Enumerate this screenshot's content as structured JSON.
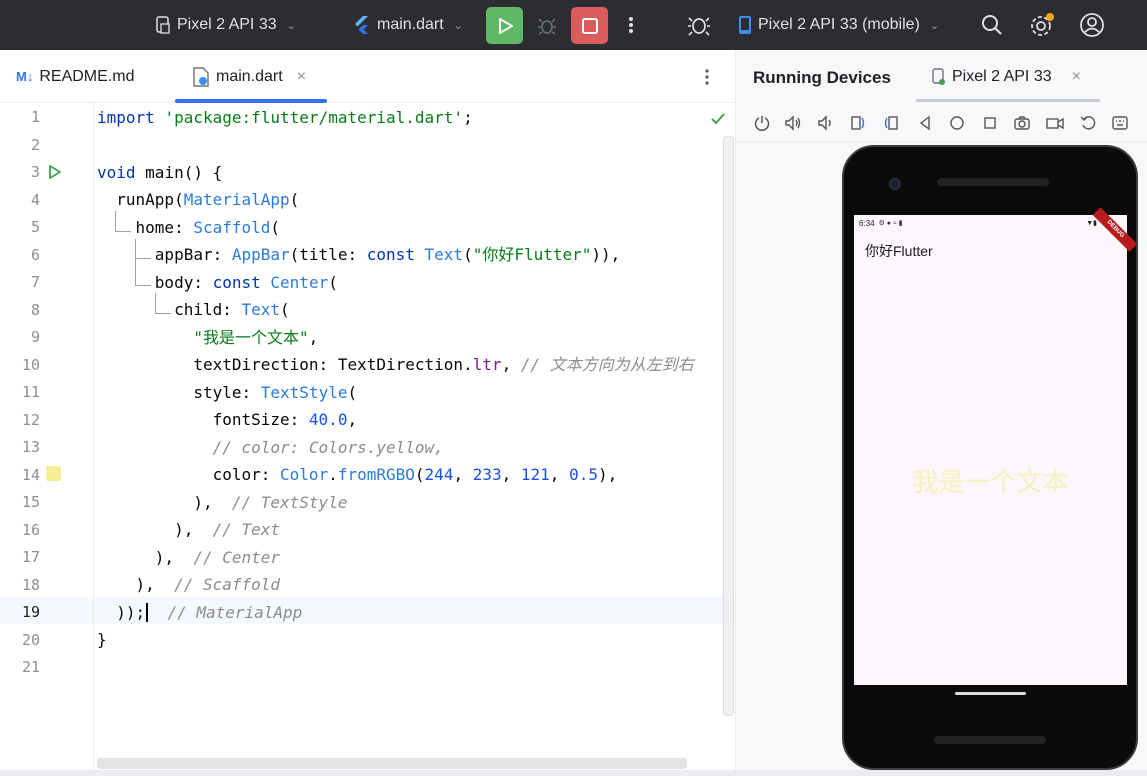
{
  "toolbar": {
    "device_selector": "Pixel 2 API 33",
    "file_selector": "main.dart",
    "running_device": "Pixel 2 API 33 (mobile)"
  },
  "tabs": [
    {
      "label": "README.md"
    },
    {
      "label": "main.dart"
    }
  ],
  "editor": {
    "line_numbers": [
      "1",
      "2",
      "3",
      "4",
      "5",
      "6",
      "7",
      "8",
      "9",
      "10",
      "11",
      "12",
      "13",
      "14",
      "15",
      "16",
      "17",
      "18",
      "19",
      "20",
      "21"
    ],
    "lines": {
      "l1a": "import",
      "l1b": "'package:flutter/material.dart'",
      "l1c": ";",
      "l3a": "void",
      "l3b": " main() {",
      "l4a": "  runApp(",
      "l4b": "MaterialApp",
      "l4c": "(",
      "l5a": "    home: ",
      "l5b": "Scaffold",
      "l5c": "(",
      "l6a": "      appBar: ",
      "l6b": "AppBar",
      "l6c": "(title: ",
      "l6d": "const",
      "l6e": " ",
      "l6f": "Text",
      "l6g": "(",
      "l6h": "\"你好Flutter\"",
      "l6i": ")),",
      "l7a": "      body: ",
      "l7b": "const",
      "l7c": " ",
      "l7d": "Center",
      "l7e": "(",
      "l8a": "        child: ",
      "l8b": "Text",
      "l8c": "(",
      "l9a": "          ",
      "l9b": "\"我是一个文本\"",
      "l9c": ",",
      "l10a": "          textDirection: TextDirection.",
      "l10b": "ltr",
      "l10c": ", ",
      "l10d": "// 文本方向为从左到右",
      "l11a": "          style: ",
      "l11b": "TextStyle",
      "l11c": "(",
      "l12a": "            fontSize: ",
      "l12b": "40.0",
      "l12c": ",",
      "l13a": "            ",
      "l13b": "// color: Colors.yellow,",
      "l14a": "            color: ",
      "l14b": "Color",
      "l14c": ".",
      "l14d": "fromRGBO",
      "l14e": "(",
      "l14f": "244",
      "l14g": ", ",
      "l14h": "233",
      "l14i": ", ",
      "l14j": "121",
      "l14k": ", ",
      "l14l": "0.5",
      "l14m": "),",
      "l15a": "          ),  ",
      "l15b": "// TextStyle",
      "l16a": "        ),  ",
      "l16b": "// Text",
      "l17a": "      ),  ",
      "l17b": "// Center",
      "l18a": "    ),  ",
      "l18b": "// Scaffold",
      "l19a": "  ));",
      "l19b": "  // MaterialApp",
      "l20a": "}"
    }
  },
  "running_devices": {
    "title": "Running Devices",
    "device_tab": "Pixel 2 API 33"
  },
  "emulator": {
    "status_time": "6:34",
    "appbar_title": "你好Flutter",
    "body_text": "我是一个文本",
    "debug_banner": "DEBUG"
  },
  "colors": {
    "run_button": "#5fb865",
    "stop_button": "#db5c5c",
    "accent": "#3574f0",
    "toolbar_bg": "#2b2d30",
    "text_color": "rgba(244,233,121,0.5)"
  }
}
